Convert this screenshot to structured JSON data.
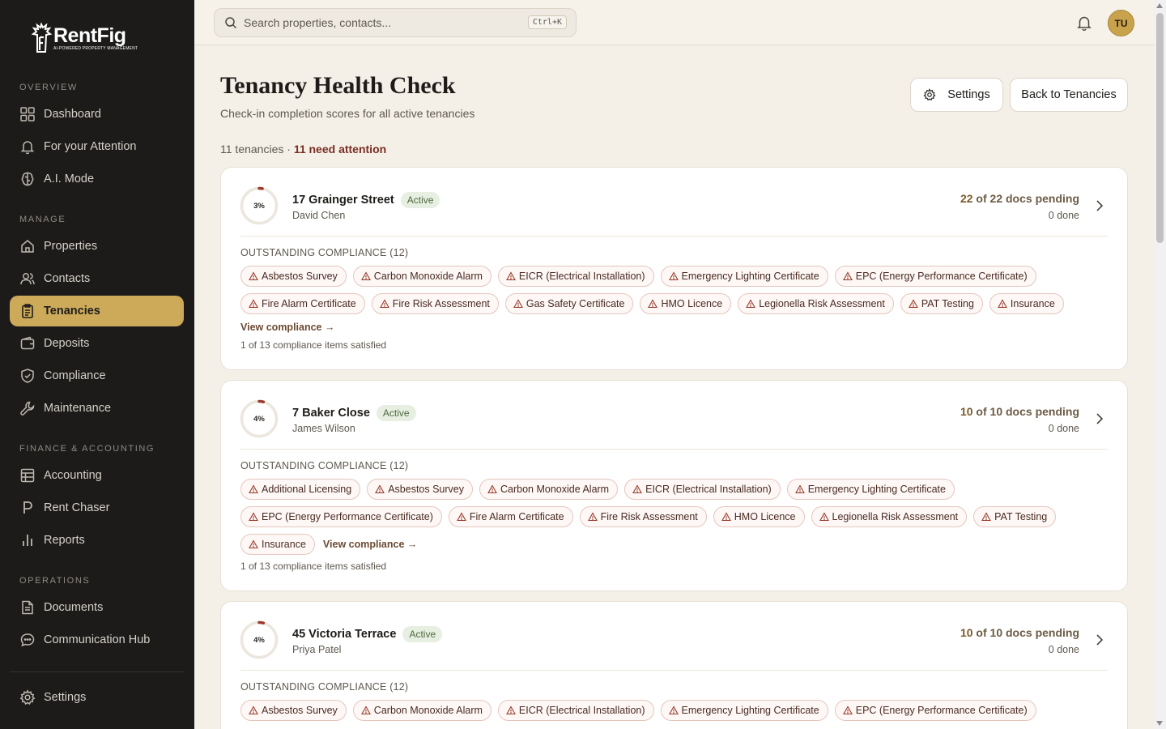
{
  "brand": {
    "name": "RentFig",
    "tagline": "AI-POWERED PROPERTY MANAGEMENT"
  },
  "sidebar": {
    "sections": [
      {
        "title": "Overview",
        "items": [
          {
            "label": "Dashboard",
            "icon": "dashboard-icon"
          },
          {
            "label": "For your Attention",
            "icon": "bell-icon"
          },
          {
            "label": "A.I. Mode",
            "icon": "ai-icon"
          }
        ]
      },
      {
        "title": "Manage",
        "items": [
          {
            "label": "Properties",
            "icon": "home-icon"
          },
          {
            "label": "Contacts",
            "icon": "users-icon"
          },
          {
            "label": "Tenancies",
            "icon": "clipboard-icon",
            "active": true
          },
          {
            "label": "Deposits",
            "icon": "wallet-icon"
          },
          {
            "label": "Compliance",
            "icon": "shield-icon"
          },
          {
            "label": "Maintenance",
            "icon": "wrench-icon"
          }
        ]
      },
      {
        "title": "Finance & Accounting",
        "items": [
          {
            "label": "Accounting",
            "icon": "ledger-icon"
          },
          {
            "label": "Rent Chaser",
            "icon": "p-icon"
          },
          {
            "label": "Reports",
            "icon": "bar-chart-icon"
          }
        ]
      },
      {
        "title": "Operations",
        "items": [
          {
            "label": "Documents",
            "icon": "document-icon"
          },
          {
            "label": "Communication Hub",
            "icon": "chat-icon"
          }
        ]
      }
    ],
    "settings_label": "Settings"
  },
  "topbar": {
    "search_placeholder": "Search properties, contacts...",
    "shortcut": "Ctrl+K",
    "avatar_initials": "TU"
  },
  "page": {
    "title": "Tenancy Health Check",
    "subtitle": "Check-in completion scores for all active tenancies",
    "settings_button": "Settings",
    "back_button": "Back to Tenancies",
    "summary_count": "11 tenancies",
    "summary_separator": " · ",
    "summary_attention": "11 need attention"
  },
  "labels": {
    "outstanding_prefix": "OUTSTANDING COMPLIANCE",
    "view_compliance": "View compliance →",
    "docs_pending_suffix": "docs pending",
    "docs_of": "of"
  },
  "tenancies": [
    {
      "score": 3,
      "score_label": "3%",
      "address": "17 Grainger Street",
      "status": "Active",
      "tenant": "David Chen",
      "pending": 22,
      "total": 22,
      "done_label": "0 done",
      "outstanding_count_label": "(12)",
      "items": [
        "Asbestos Survey",
        "Carbon Monoxide Alarm",
        "EICR (Electrical Installation)",
        "Emergency Lighting Certificate",
        "EPC (Energy Performance Certificate)",
        "Fire Alarm Certificate",
        "Fire Risk Assessment",
        "Gas Safety Certificate",
        "HMO Licence",
        "Legionella Risk Assessment",
        "PAT Testing",
        "Insurance"
      ],
      "satisfied": "1 of 13 compliance items satisfied"
    },
    {
      "score": 4,
      "score_label": "4%",
      "address": "7 Baker Close",
      "status": "Active",
      "tenant": "James Wilson",
      "pending": 10,
      "total": 10,
      "done_label": "0 done",
      "outstanding_count_label": "(12)",
      "items": [
        "Additional Licensing",
        "Asbestos Survey",
        "Carbon Monoxide Alarm",
        "EICR (Electrical Installation)",
        "Emergency Lighting Certificate",
        "EPC (Energy Performance Certificate)",
        "Fire Alarm Certificate",
        "Fire Risk Assessment",
        "HMO Licence",
        "Legionella Risk Assessment",
        "PAT Testing",
        "Insurance"
      ],
      "satisfied": "1 of 13 compliance items satisfied"
    },
    {
      "score": 4,
      "score_label": "4%",
      "address": "45 Victoria Terrace",
      "status": "Active",
      "tenant": "Priya Patel",
      "pending": 10,
      "total": 10,
      "done_label": "0 done",
      "outstanding_count_label": "(12)",
      "items": [
        "Asbestos Survey",
        "Carbon Monoxide Alarm",
        "EICR (Electrical Installation)",
        "Emergency Lighting Certificate",
        "EPC (Energy Performance Certificate)"
      ],
      "satisfied": ""
    }
  ],
  "colors": {
    "accent": "#cdaa5a",
    "sidebar_bg": "#1c1b1a",
    "warning_text": "#7a2e22",
    "ring_progress": "#9b3a2c"
  }
}
